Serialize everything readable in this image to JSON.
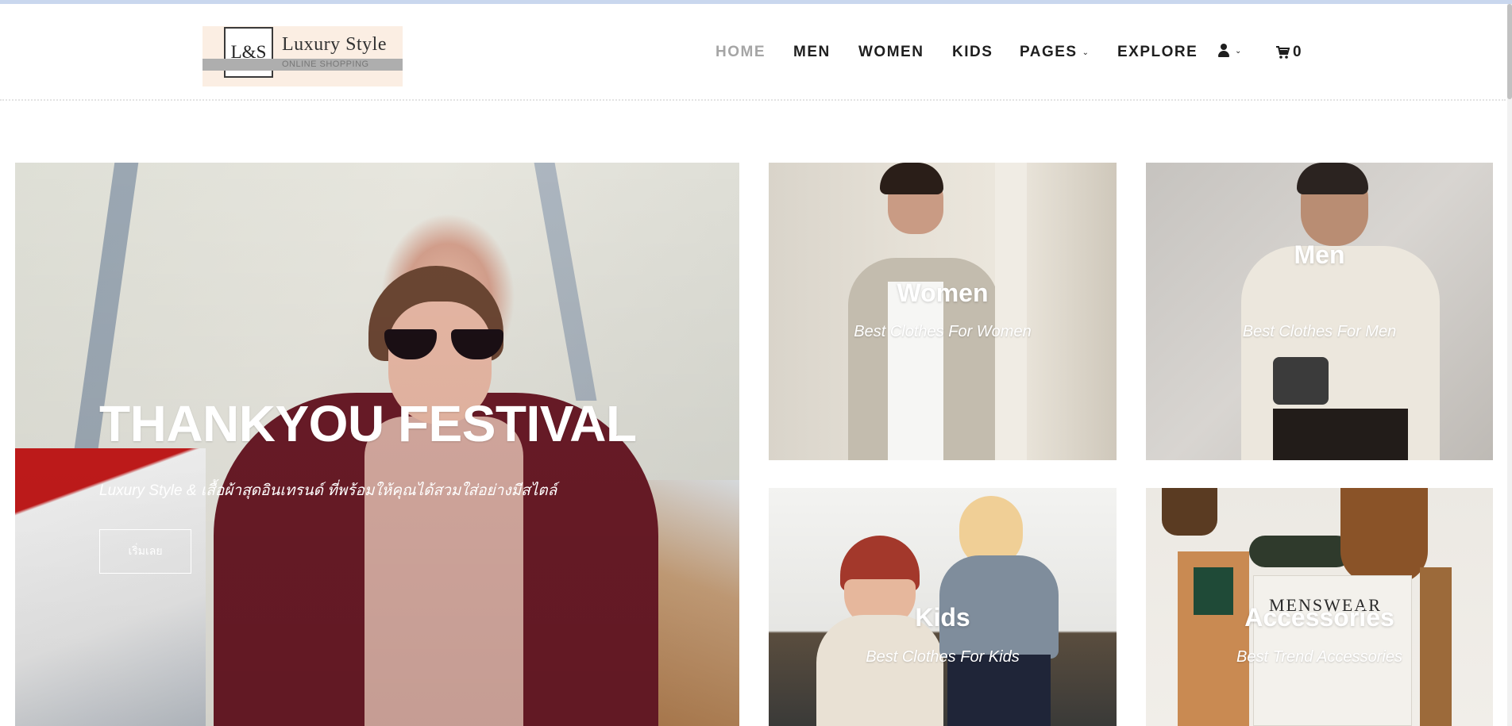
{
  "brand": {
    "logo_mark": "L&S",
    "name": "Luxury Style",
    "tagline": "ONLINE SHOPPING"
  },
  "nav": {
    "items": [
      {
        "label": "HOME",
        "active": true
      },
      {
        "label": "MEN"
      },
      {
        "label": "WOMEN"
      },
      {
        "label": "KIDS"
      },
      {
        "label": "PAGES"
      },
      {
        "label": "EXPLORE"
      }
    ],
    "cart_count": "0",
    "icons": [
      "user-icon",
      "cart-icon",
      "chevron-down-icon"
    ]
  },
  "hero": {
    "title": "THANKYOU FESTIVAL",
    "subtitle": "Luxury Style & เสื้อผ้าสุดอินเทรนด์ ที่พร้อมให้คุณได้สวมใส่อย่างมีสไตล์",
    "button_label": "เริ่มเลย"
  },
  "tiles": [
    {
      "title": "Women",
      "subtitle": "Best Clothes For Women"
    },
    {
      "title": "Men",
      "subtitle": "Best Clothes For Men"
    },
    {
      "title": "Kids",
      "subtitle": "Best Clothes For Kids"
    },
    {
      "title": "Accessories",
      "subtitle": "Best Trend Accessories"
    }
  ],
  "colors": {
    "nav_active": "#a5a5a5",
    "nav_text": "#1e1e1e",
    "logo_background": "#fbeee3",
    "hero_coat": "#6a1b27"
  }
}
